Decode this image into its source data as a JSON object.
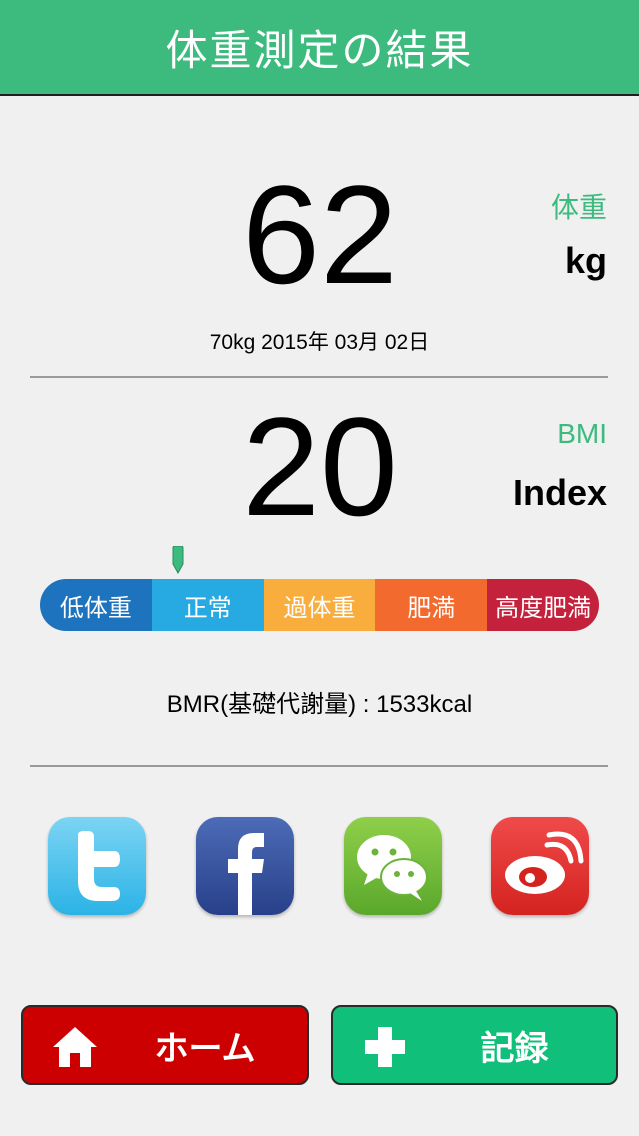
{
  "header": {
    "title": "体重測定の結果"
  },
  "weight": {
    "value": "62",
    "label": "体重",
    "unit": "kg",
    "date": "70kg 2015年 03月 02日"
  },
  "bmi": {
    "value": "20",
    "label": "BMI",
    "unit": "Index",
    "marker_category": "正常"
  },
  "bmi_scale": {
    "segments": [
      {
        "label": "低体重",
        "color": "#1e73be"
      },
      {
        "label": "正常",
        "color": "#27a9e1"
      },
      {
        "label": "過体重",
        "color": "#f9ad3c"
      },
      {
        "label": "肥満",
        "color": "#f26a2e"
      },
      {
        "label": "高度肥満",
        "color": "#c4213c"
      }
    ],
    "marker_color": "#3dba7e"
  },
  "bmr": {
    "text": "BMR(基礎代謝量) : 1533kcal"
  },
  "share": {
    "icons": [
      "twitter-icon",
      "facebook-icon",
      "wechat-icon",
      "weibo-icon"
    ]
  },
  "buttons": {
    "home_label": "ホーム",
    "record_label": "記録"
  },
  "colors": {
    "accent": "#3dba7e",
    "home": "#cc0000",
    "record": "#10c07a"
  }
}
